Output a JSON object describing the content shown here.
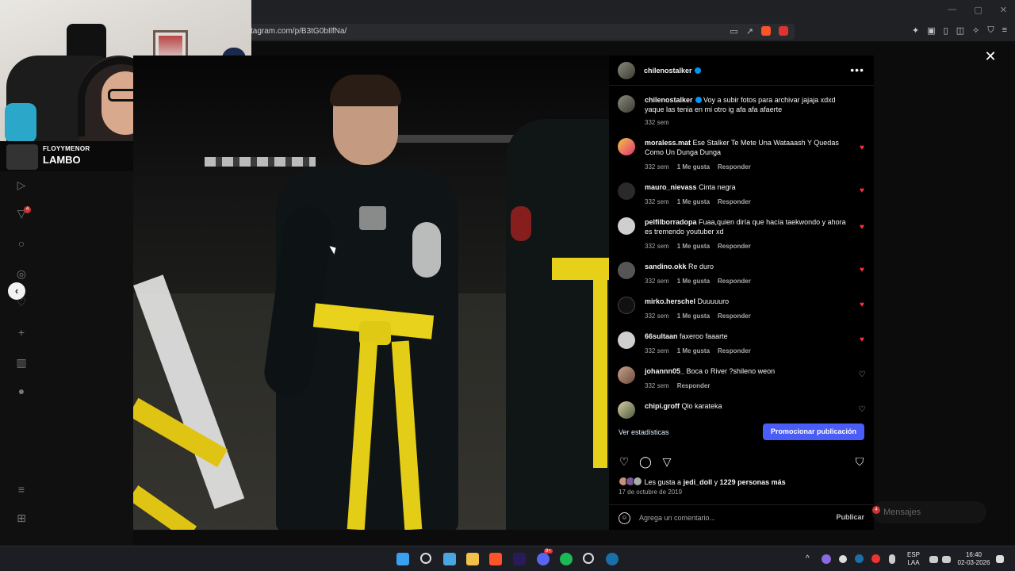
{
  "browser": {
    "url": "tagram.com/p/B3tG0bIlfNa/",
    "window_controls": [
      "—",
      "▢",
      "✕"
    ]
  },
  "stream_overlay": {
    "channel_small": "FLOYYMENOR",
    "channel_big": "LAMBO"
  },
  "sidebar": {
    "notification_count": "4"
  },
  "post": {
    "author": "chilenostalker",
    "caption": "Voy a subir fotos para archivar jajaja xdxd yaque las tenia en mi otro ig afa afa afaerte",
    "caption_time": "332 sem",
    "comments": [
      {
        "user": "moraless.mat",
        "text": "Ese Stalker Te Mete Una Wataaash Y Quedas Como Un Dunga Dunga",
        "time": "332 sem",
        "likes": "1 Me gusta",
        "reply": "Responder",
        "liked": true
      },
      {
        "user": "mauro_nievass",
        "text": "Cinta negra",
        "time": "332 sem",
        "likes": "1 Me gusta",
        "reply": "Responder",
        "liked": true
      },
      {
        "user": "pelfilborradopa",
        "text": "Fuaa,quien diría que hacía taekwondo y ahora es tremendo youtuber xd",
        "time": "332 sem",
        "likes": "1 Me gusta",
        "reply": "Responder",
        "liked": true
      },
      {
        "user": "sandino.okk",
        "text": "Re duro",
        "time": "332 sem",
        "likes": "1 Me gusta",
        "reply": "Responder",
        "liked": true
      },
      {
        "user": "mirko.herschel",
        "text": "Duuuuuro",
        "time": "332 sem",
        "likes": "1 Me gusta",
        "reply": "Responder",
        "liked": true
      },
      {
        "user": "66sultaan",
        "text": "faxeroo faaarte",
        "time": "332 sem",
        "likes": "1 Me gusta",
        "reply": "Responder",
        "liked": true
      },
      {
        "user": "johannn05_",
        "text": "Boca o River ?shileno weon",
        "time": "332 sem",
        "likes": "",
        "reply": "Responder",
        "liked": false
      },
      {
        "user": "chipi.groff",
        "text": "Qlo karateka",
        "time": "",
        "likes": "",
        "reply": "",
        "liked": false
      }
    ],
    "stats_link": "Ver estadísticas",
    "promote_label": "Promocionar publicación",
    "likes_prefix": "Les gusta a ",
    "likes_user": "jedi_doll",
    "likes_mid": " y ",
    "likes_count": "1229 personas más",
    "date": "17 de octubre de 2019",
    "comment_placeholder": "Agrega un comentario...",
    "publish_label": "Publicar"
  },
  "messages": {
    "label": "Mensajes",
    "badge": "4"
  },
  "taskbar": {
    "lang_top": "ESP",
    "lang_bottom": "LAA",
    "time": "16:40",
    "date": "02-03-2026",
    "discord_badge": "9+"
  },
  "colors": {
    "like_red": "#ff3040",
    "promote_blue": "#4a5df9",
    "verified_blue": "#0095f6"
  }
}
